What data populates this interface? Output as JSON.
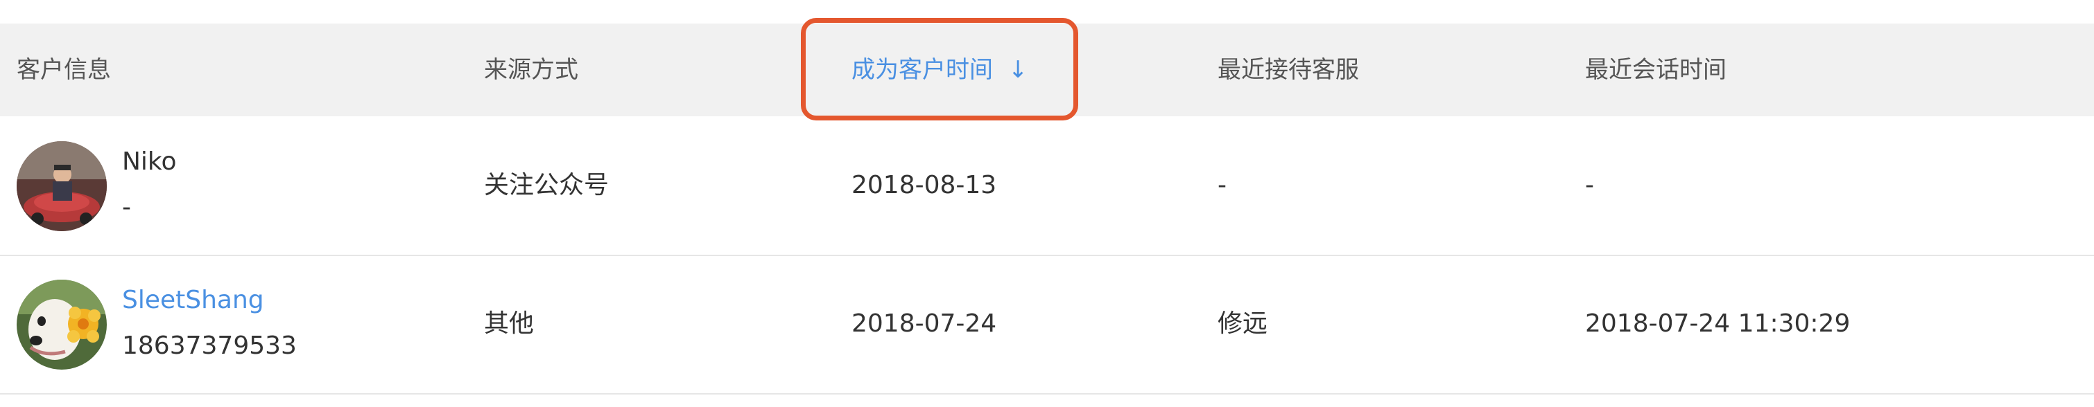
{
  "columns": {
    "customer_info": "客户信息",
    "source": "来源方式",
    "became_customer_time": "成为客户时间",
    "became_customer_sort_icon": "↓",
    "recent_agent": "最近接待客服",
    "recent_session_time": "最近会话时间"
  },
  "rows": [
    {
      "name": "Niko",
      "phone": "-",
      "source": "关注公众号",
      "became_customer_time": "2018-08-13",
      "recent_agent": "-",
      "recent_session_time": "-",
      "avatar_icon": "child-in-toy-car-photo"
    },
    {
      "name": "SleetShang",
      "phone": "18637379533",
      "source": "其他",
      "became_customer_time": "2018-07-24",
      "recent_agent": "修远",
      "recent_session_time": "2018-07-24 11:30:29",
      "avatar_icon": "dog-with-flower-photo"
    }
  ],
  "colors": {
    "header_bg": "#f1f1f1",
    "sorted_accent": "#4a90e2",
    "highlight_border": "#e4572e"
  }
}
